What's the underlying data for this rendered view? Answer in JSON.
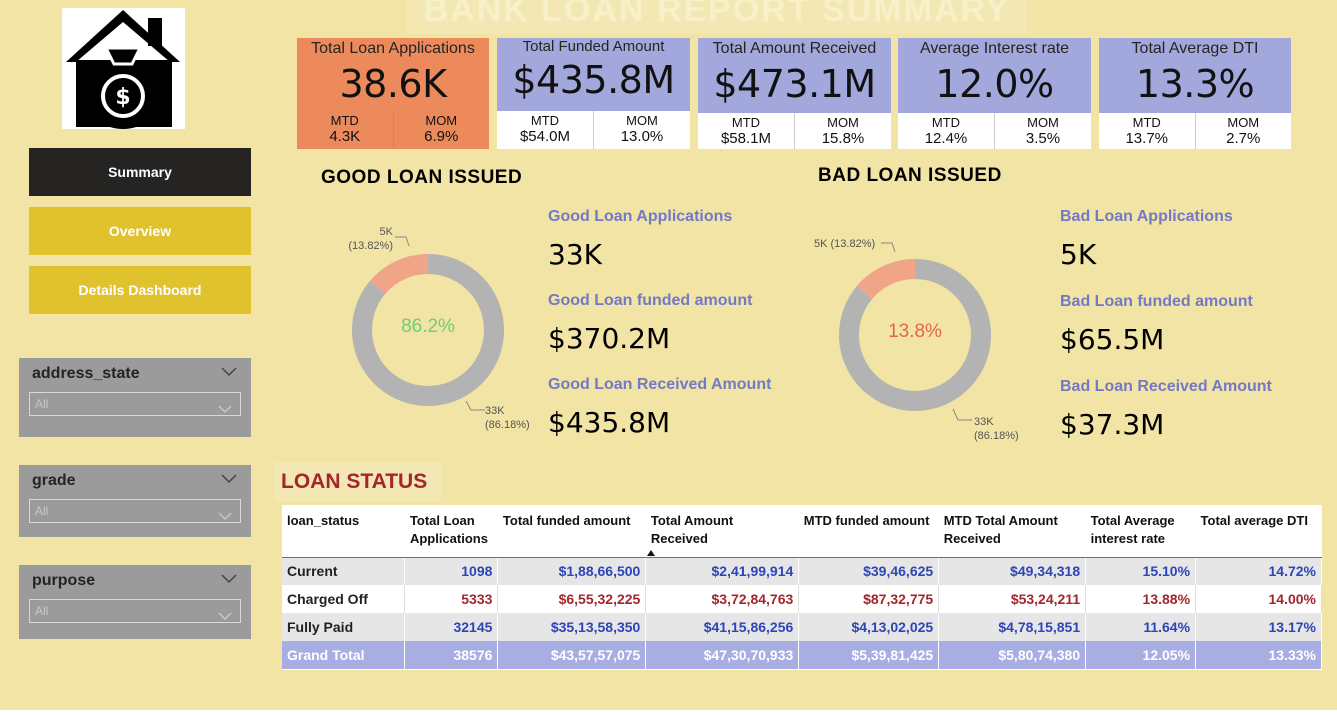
{
  "title": "BANK LOAN REPORT SUMMARY",
  "nav": {
    "summary": "Summary",
    "overview": "Overview",
    "details": "Details Dashboard"
  },
  "slicers": [
    {
      "label": "address_state",
      "value": "All"
    },
    {
      "label": "grade",
      "value": "All"
    },
    {
      "label": "purpose",
      "value": "All"
    }
  ],
  "kpis": [
    {
      "title": "Total Loan Applications",
      "value": "38.6K",
      "mtd_label": "MTD",
      "mtd": "4.3K",
      "mom_label": "MOM",
      "mom": "6.9%"
    },
    {
      "title": "Total Funded Amount",
      "value": "$435.8M",
      "mtd_label": "MTD",
      "mtd": "$54.0M",
      "mom_label": "MOM",
      "mom": "13.0%"
    },
    {
      "title": "Total Amount Received",
      "value": "$473.1M",
      "mtd_label": "MTD",
      "mtd": "$58.1M",
      "mom_label": "MOM",
      "mom": "15.8%"
    },
    {
      "title": "Average Interest rate",
      "value": "12.0%",
      "mtd_label": "MTD",
      "mtd": "12.4%",
      "mom_label": "MOM",
      "mom": "3.5%"
    },
    {
      "title": "Total Average DTI",
      "value": "13.3%",
      "mtd_label": "MTD",
      "mtd": "13.7%",
      "mom_label": "MOM",
      "mom": "2.7%"
    }
  ],
  "good": {
    "header": "GOOD LOAN ISSUED",
    "center": "86.2%",
    "slice_small_value": "5K",
    "slice_small_pct": "(13.82%)",
    "slice_big_value": "33K",
    "slice_big_pct": "(86.18%)",
    "apps_label": "Good Loan Applications",
    "apps": "33K",
    "funded_label": "Good Loan funded amount",
    "funded": "$370.2M",
    "received_label": "Good Loan Received Amount",
    "received": "$435.8M"
  },
  "bad": {
    "header": "BAD LOAN ISSUED",
    "center": "13.8%",
    "slice_small": "5K (13.82%)",
    "slice_big_value": "33K",
    "slice_big_pct": "(86.18%)",
    "apps_label": "Bad Loan Applications",
    "apps": "5K",
    "funded_label": "Bad Loan funded amount",
    "funded": "$65.5M",
    "received_label": "Bad Loan Received Amount",
    "received": "$37.3M"
  },
  "colors": {
    "kpi_orange": "#ec8a5c",
    "kpi_orange_foot": "#ec8a5c",
    "kpi_lavender": "#a3a8dc",
    "donut_grey": "#b3b3b3",
    "donut_salmon": "#f0a488",
    "good_center": "#6bcf7a",
    "bad_center": "#e2674a"
  },
  "chart_data": [
    {
      "type": "pie",
      "title": "GOOD LOAN ISSUED",
      "categories": [
        "5K",
        "33K"
      ],
      "values": [
        13.82,
        86.18
      ],
      "center_label": "86.2%"
    },
    {
      "type": "pie",
      "title": "BAD LOAN ISSUED",
      "categories": [
        "5K",
        "33K"
      ],
      "values": [
        13.82,
        86.18
      ],
      "center_label": "13.8%"
    }
  ],
  "loan_status": {
    "title": "LOAN STATUS",
    "columns": [
      "loan_status",
      "Total Loan Applications",
      "Total funded amount",
      "Total Amount Received",
      "MTD funded amount",
      "MTD Total Amount Received",
      "Total Average interest rate",
      "Total average DTI"
    ],
    "rows": [
      [
        "Current",
        "1098",
        "$1,88,66,500",
        "$2,41,99,914",
        "$39,46,625",
        "$49,34,318",
        "15.10%",
        "14.72%"
      ],
      [
        "Charged Off",
        "5333",
        "$6,55,32,225",
        "$3,72,84,763",
        "$87,32,775",
        "$53,24,211",
        "13.88%",
        "14.00%"
      ],
      [
        "Fully Paid",
        "32145",
        "$35,13,58,350",
        "$41,15,86,256",
        "$4,13,02,025",
        "$4,78,15,851",
        "11.64%",
        "13.17%"
      ]
    ],
    "total": [
      "Grand Total",
      "38576",
      "$43,57,57,075",
      "$47,30,70,933",
      "$5,39,81,425",
      "$5,80,74,380",
      "12.05%",
      "13.33%"
    ]
  }
}
